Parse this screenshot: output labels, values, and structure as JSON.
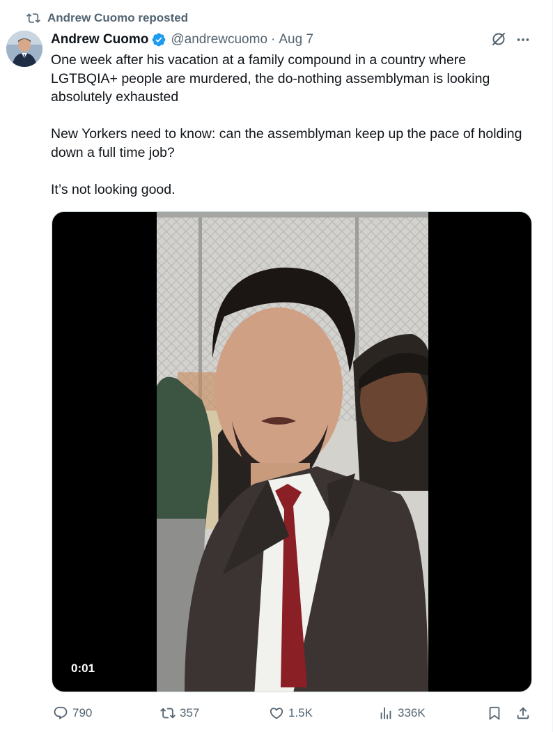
{
  "repost": {
    "label": "Andrew Cuomo reposted",
    "icon": "repost-icon"
  },
  "author": {
    "name": "Andrew Cuomo",
    "handle": "@andrewcuomo",
    "separator": "·",
    "date": "Aug 7",
    "verified": true,
    "avatar_icon": "avatar",
    "verified_color": "#1d9bf0"
  },
  "tweet": {
    "paragraphs": [
      "One week after his vacation at a family compound in a country where LGTBQIA+ people are murdered, the do-nothing assemblyman is looking absolutely exhausted",
      "New Yorkers need to know: can the assemblyman keep up the pace of holding down a full time job?",
      "It’s not looking good."
    ]
  },
  "media": {
    "timestamp": "0:01"
  },
  "actions": {
    "replies": "790",
    "reposts": "357",
    "likes": "1.5K",
    "views": "336K"
  },
  "colors": {
    "text": "#0f1419",
    "secondary": "#536471",
    "accent": "#1d9bf0"
  }
}
